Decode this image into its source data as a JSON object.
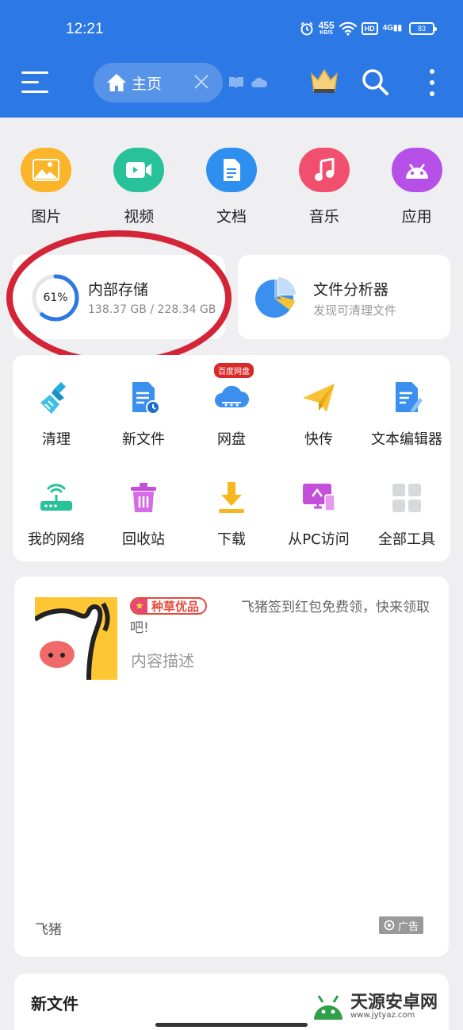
{
  "status_bar": {
    "time": "12:21",
    "net_speed_value": "455",
    "net_speed_unit": "KB/S",
    "hd_label": "HD",
    "signal_label": "4G",
    "battery": "83"
  },
  "toolbar": {
    "home_tab_label": "主页"
  },
  "categories": [
    {
      "label": "图片",
      "color": "#fbb52b",
      "icon": "image-icon"
    },
    {
      "label": "视频",
      "color": "#27c29a",
      "icon": "video-icon"
    },
    {
      "label": "文档",
      "color": "#2d8ff0",
      "icon": "document-icon"
    },
    {
      "label": "音乐",
      "color": "#f0506e",
      "icon": "music-icon"
    },
    {
      "label": "应用",
      "color": "#b650e8",
      "icon": "android-icon"
    }
  ],
  "storage": {
    "title": "内部存储",
    "percent_label": "61%",
    "percent": 61,
    "usage": "138.37 GB / 228.34 GB"
  },
  "analyzer": {
    "title": "文件分析器",
    "subtitle": "发现可清理文件"
  },
  "tools": [
    {
      "label": "清理",
      "icon": "broom-icon"
    },
    {
      "label": "新文件",
      "icon": "new-file-icon"
    },
    {
      "label": "网盘",
      "icon": "cloud-drive-icon",
      "badge": "百度网盘"
    },
    {
      "label": "快传",
      "icon": "paper-plane-icon"
    },
    {
      "label": "文本编辑器",
      "icon": "text-editor-icon"
    },
    {
      "label": "我的网络",
      "icon": "router-icon"
    },
    {
      "label": "回收站",
      "icon": "trash-icon"
    },
    {
      "label": "下载",
      "icon": "download-icon"
    },
    {
      "label": "从PC访问",
      "icon": "pc-access-icon"
    },
    {
      "label": "全部工具",
      "icon": "grid-icon"
    }
  ],
  "ad": {
    "tag": "种草优品",
    "headline": "飞猪签到红包免费领，快来领取吧!",
    "description": "内容描述",
    "brand": "飞猪",
    "ad_label": "广告"
  },
  "new_files": {
    "title": "新文件"
  },
  "watermark": {
    "name": "天源安卓网",
    "url": "www.jytyaz.com"
  },
  "colors": {
    "header_blue": "#2c78e4",
    "annotation_red": "#d42438"
  }
}
